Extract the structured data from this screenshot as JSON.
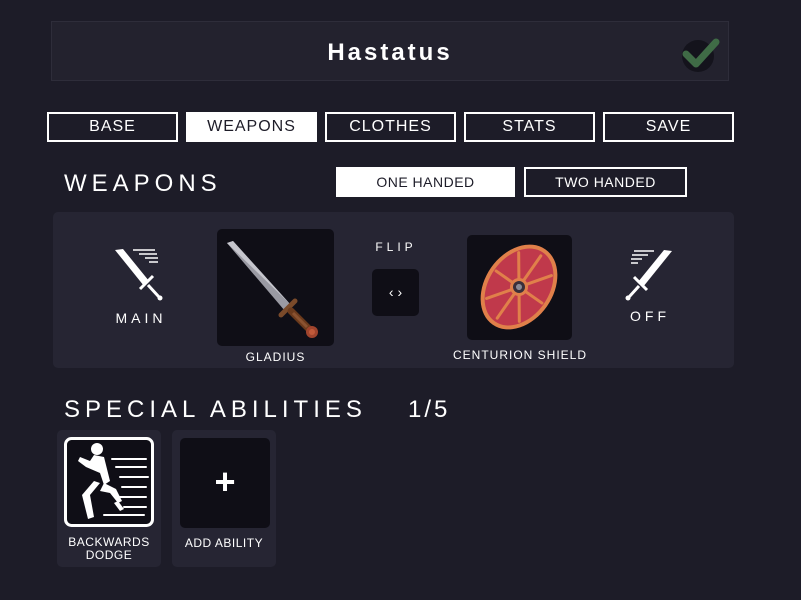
{
  "header": {
    "title": "Hastatus",
    "confirm_icon": "checkmark-icon"
  },
  "tabs": [
    {
      "label": "BASE",
      "active": false
    },
    {
      "label": "WEAPONS",
      "active": true
    },
    {
      "label": "CLOTHES",
      "active": false
    },
    {
      "label": "STATS",
      "active": false
    },
    {
      "label": "SAVE",
      "active": false
    }
  ],
  "weapons": {
    "heading": "WEAPONS",
    "toggle": {
      "one_handed": "ONE HANDED",
      "two_handed": "TWO HANDED",
      "selected": "ONE HANDED"
    },
    "main": {
      "label": "MAIN",
      "item_name": "GLADIUS",
      "icon": "sword-icon"
    },
    "flip": {
      "label": "FLIP",
      "button_text": "‹ ›"
    },
    "off": {
      "label": "OFF",
      "item_name": "CENTURION SHIELD",
      "icon": "sword-icon"
    }
  },
  "abilities": {
    "heading": "SPECIAL ABILITIES",
    "count": "1/5",
    "items": [
      {
        "name_line1": "BACKWARDS",
        "name_line2": "DODGE",
        "icon": "dodge-icon"
      }
    ],
    "add": {
      "label": "ADD ABILITY",
      "symbol": "+"
    }
  },
  "colors": {
    "background": "#1d1c28",
    "panel": "#262533",
    "slot": "#0f0e16",
    "shield_red": "#c0394b",
    "shield_rim": "#e0804a"
  }
}
